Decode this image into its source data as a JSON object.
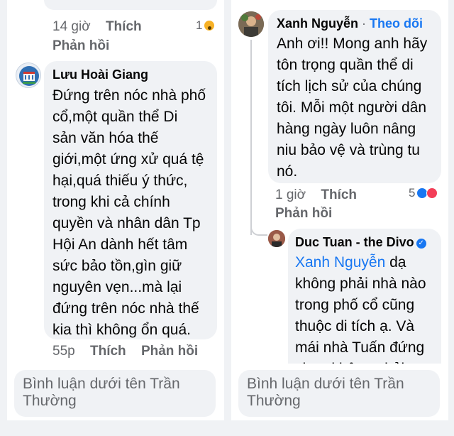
{
  "left": {
    "prev_meta": {
      "time": "14 giờ",
      "like": "Thích",
      "reply": "Phản hồi",
      "reaction_count": "1"
    },
    "comment": {
      "author": "Lưu Hoài Giang",
      "lines": [
        "Đứng trên nóc nhà phố",
        "cổ,một quần thể Di",
        "sản văn hóa thế",
        "giới,một ứng xử quá tệ",
        "hại,quá thiếu ý thức,",
        "trong khi cả chính",
        "quyền và nhân dân Tp",
        "Hội An dành hết tâm",
        "sức bảo tồn,gìn giữ",
        "nguyên vẹn...mà lại",
        "đứng trên nóc nhà thế",
        "kia thì không ổn quá."
      ],
      "time": "55p",
      "like": "Thích",
      "reply": "Phản hồi"
    },
    "input_placeholder": [
      "Bình luận dưới tên Trần",
      "Thường"
    ]
  },
  "right": {
    "comment": {
      "author": "Xanh Nguyễn",
      "separator": "·",
      "follow": "Theo dõi",
      "lines": [
        "Anh ơi!! Mong anh hãy",
        "tôn trọng quần thể di",
        "tích lịch sử của chúng",
        "tôi. Mỗi một người dân",
        "hàng ngày luôn nâng",
        "niu bảo vệ và trùng tu",
        "nó."
      ],
      "time": "1 giờ",
      "like": "Thích",
      "reply": "Phản hồi",
      "reaction_count": "5"
    },
    "reply_comment": {
      "author": "Duc Tuan - the Divo",
      "mention": "Xanh Nguyễn",
      "first_rest": " dạ",
      "lines": [
        "không phải nhà nào",
        "trong phố cổ cũng",
        "thuộc di tích ạ. Và",
        "mái nhà Tuấn đứng",
        "chụp không phải..."
      ]
    },
    "input_placeholder": [
      "Bình luận dưới tên Trần",
      "Thường"
    ]
  },
  "colors": {
    "accent": "#1877f2",
    "bubble": "#f0f2f5",
    "muted": "#65676b"
  }
}
